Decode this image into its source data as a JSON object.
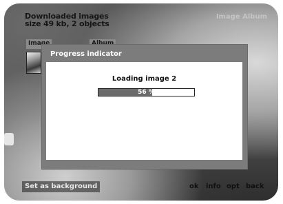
{
  "header": {
    "title": "Downloaded images",
    "subtitle": "size 49 kb, 2 objects",
    "right_label": "Image Album"
  },
  "tabs": [
    {
      "label": "Image"
    },
    {
      "label": "Album"
    }
  ],
  "dialog": {
    "title": "Progress indicator",
    "loading_text": "Loading image 2",
    "progress": {
      "percent": 56,
      "label": "56 %"
    }
  },
  "footer": {
    "left_label": "Set as background",
    "buttons": [
      {
        "label": "ok"
      },
      {
        "label": "info"
      },
      {
        "label": "opt"
      },
      {
        "label": "back"
      }
    ]
  },
  "colors": {
    "dialog_frame": "#7c7c7c",
    "dialog_body": "#ffffff",
    "progress_fill": "#6b6b6b"
  }
}
